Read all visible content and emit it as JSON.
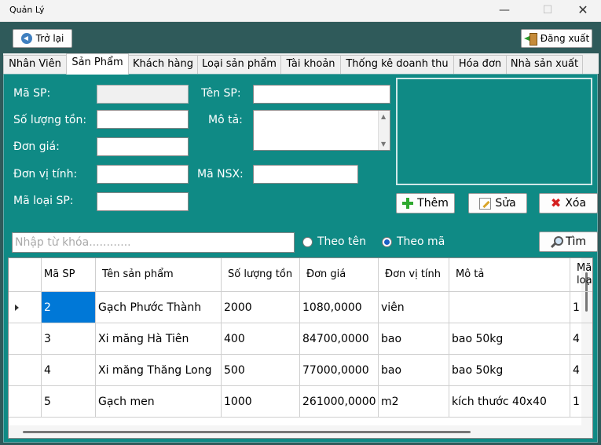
{
  "window": {
    "title": "Quản Lý",
    "minimize": "—",
    "maximize": "☐",
    "close": "✕"
  },
  "toolbar": {
    "back_label": "Trở lại",
    "logout_label": "Đăng xuất"
  },
  "tabs": [
    {
      "label": "Nhân Viên"
    },
    {
      "label": "Sản Phẩm"
    },
    {
      "label": "Khách hàng"
    },
    {
      "label": "Loại sản phẩm"
    },
    {
      "label": "Tài khoản"
    },
    {
      "label": "Thống kê doanh thu"
    },
    {
      "label": "Hóa đơn"
    },
    {
      "label": "Nhà sản xuất"
    }
  ],
  "form": {
    "ma_sp_label": "Mã SP:",
    "so_luong_label": "Số lượng tồn:",
    "don_gia_label": "Đơn giá:",
    "don_vi_label": "Đơn vị tính:",
    "ma_loai_label": "Mã loại SP:",
    "ten_sp_label": "Tên SP:",
    "mo_ta_label": "Mô tả:",
    "ma_nsx_label": "Mã NSX:",
    "ma_sp_value": "",
    "so_luong_value": "",
    "don_gia_value": "",
    "don_vi_value": "",
    "ma_loai_value": "",
    "ten_sp_value": "",
    "ma_nsx_value": ""
  },
  "actions": {
    "add_label": "Thêm",
    "edit_label": "Sửa",
    "delete_label": "Xóa",
    "search_label": "Tìm"
  },
  "search": {
    "placeholder": "Nhập từ khóa............",
    "by_name_label": "Theo tên",
    "by_code_label": "Theo mã",
    "selected": "Theo mã"
  },
  "table": {
    "columns": [
      "Mã SP",
      "Tên sản phẩm",
      "Số lượng tồn",
      "Đơn giá",
      "Đơn vị tính",
      "Mô tả",
      "Mã loại"
    ],
    "rows": [
      [
        "2",
        "Gạch Phước Thành",
        "2000",
        "1080,0000",
        "viên",
        "",
        "1"
      ],
      [
        "3",
        "Xi măng Hà Tiên",
        "400",
        "84700,0000",
        "bao",
        "bao 50kg",
        "4"
      ],
      [
        "4",
        "Xi măng Thăng Long",
        "500",
        "77000,0000",
        "bao",
        "bao 50kg",
        "4"
      ],
      [
        "5",
        "Gạch men",
        "1000",
        "261000,0000",
        "m2",
        "kích thước 40x40",
        "1"
      ]
    ],
    "selected_row": 0
  }
}
